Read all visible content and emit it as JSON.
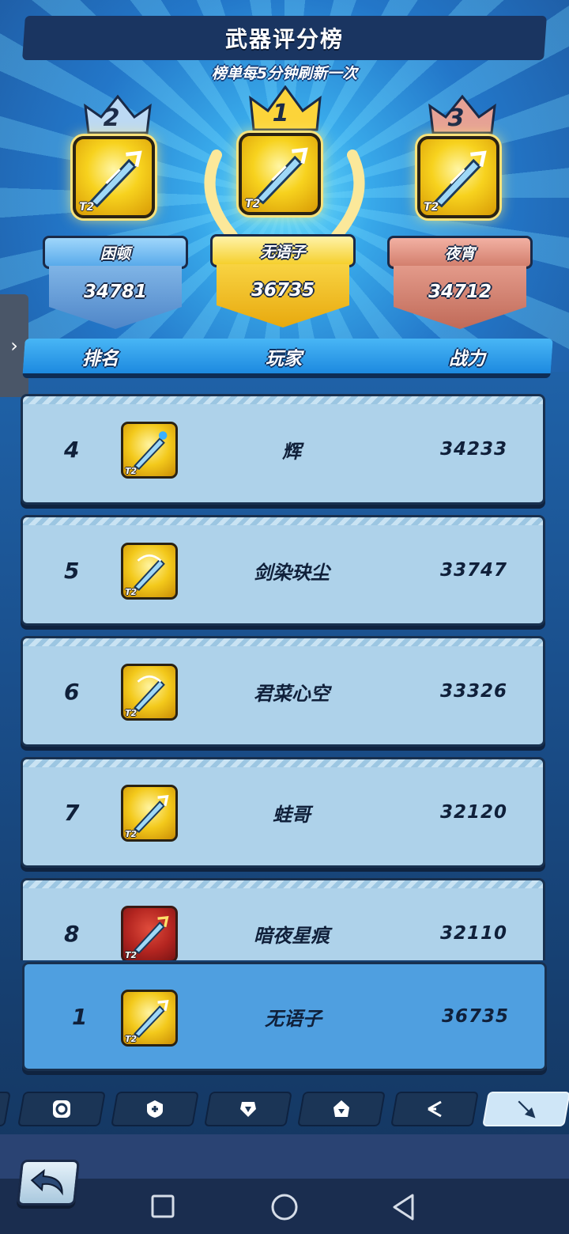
{
  "header": {
    "title": "武器评分榜",
    "subtitle": "榜单每5分钟刷新一次"
  },
  "podium": [
    {
      "rank": "2",
      "name": "困顿",
      "score": "34781",
      "color": "#8ec2f0"
    },
    {
      "rank": "1",
      "name": "无语子",
      "score": "36735",
      "color": "#f7d23a"
    },
    {
      "rank": "3",
      "name": "夜宵",
      "score": "34712",
      "color": "#d9877a"
    }
  ],
  "tier_label": "T2",
  "columns": {
    "rank": "排名",
    "player": "玩家",
    "power": "战力"
  },
  "rows": [
    {
      "rank": "4",
      "name": "辉",
      "score": "34233",
      "icon": "sword-icon"
    },
    {
      "rank": "5",
      "name": "剑染玦尘",
      "score": "33747",
      "icon": "sword-icon"
    },
    {
      "rank": "6",
      "name": "君菜心空",
      "score": "33326",
      "icon": "sword-icon"
    },
    {
      "rank": "7",
      "name": "蛙哥",
      "score": "32120",
      "icon": "sword-icon"
    },
    {
      "rank": "8",
      "name": "暗夜星痕",
      "score": "32110",
      "icon": "sword-icon"
    }
  ],
  "my_row": {
    "rank": "1",
    "name": "无语子",
    "score": "36735"
  },
  "side_tab_glyph": "›",
  "tabs": [
    "spiral-icon",
    "shield-plus-icon",
    "armor-icon",
    "helmet-icon",
    "branch-icon",
    "sword-icon"
  ]
}
